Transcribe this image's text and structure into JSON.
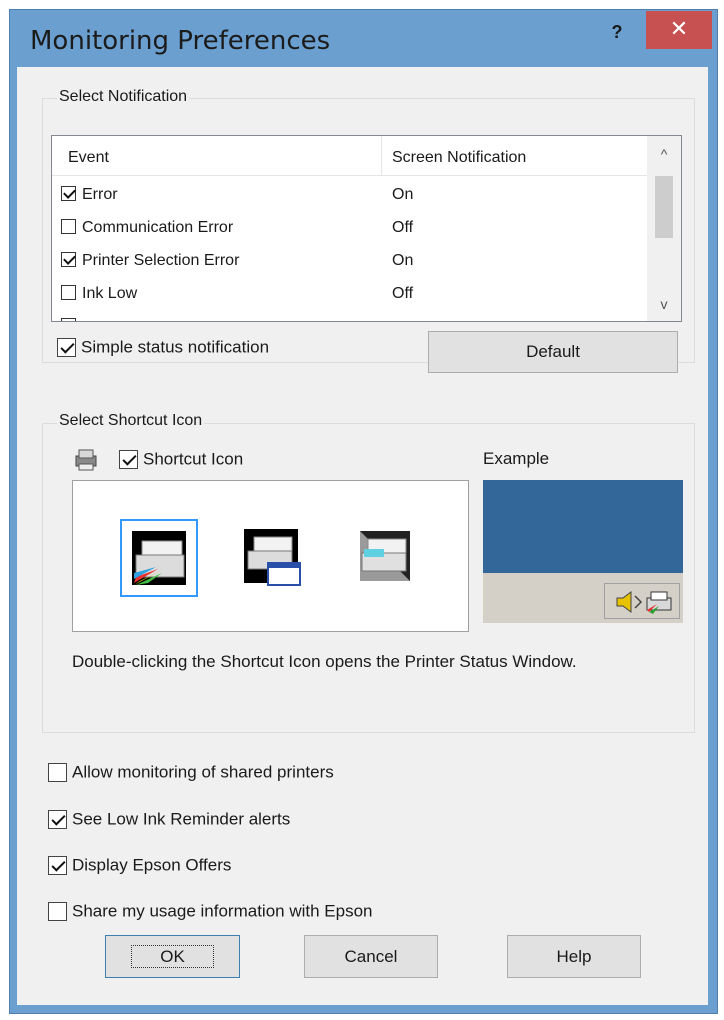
{
  "window": {
    "title": "Monitoring Preferences",
    "help_label": "?",
    "close_label": "✕"
  },
  "notification": {
    "group_title": "Select Notification",
    "columns": [
      "Event",
      "Screen Notification"
    ],
    "rows": [
      {
        "event": "Error",
        "status": "On",
        "checked": true
      },
      {
        "event": "Communication Error",
        "status": "Off",
        "checked": false
      },
      {
        "event": "Printer Selection Error",
        "status": "On",
        "checked": true
      },
      {
        "event": "Ink Low",
        "status": "Off",
        "checked": false
      }
    ],
    "scroll_up": "^",
    "scroll_down": "v",
    "simple_status_label": "Simple status notification",
    "simple_status_checked": true,
    "default_button": "Default"
  },
  "shortcut": {
    "group_title": "Select Shortcut Icon",
    "shortcut_label": "Shortcut Icon",
    "shortcut_checked": true,
    "example_label": "Example",
    "description": "Double-clicking the Shortcut Icon opens the Printer Status Window."
  },
  "options": [
    {
      "label": "Allow monitoring of shared printers",
      "checked": false
    },
    {
      "label": "See Low Ink Reminder alerts",
      "checked": true
    },
    {
      "label": "Display Epson Offers",
      "checked": true
    },
    {
      "label": "Share my usage information with Epson",
      "checked": false
    }
  ],
  "buttons": {
    "ok": "OK",
    "cancel": "Cancel",
    "help": "Help"
  },
  "colors": {
    "titlebar": "#6b9fcf",
    "close": "#c75050",
    "example_desktop": "#336699",
    "selection": "#3399ff"
  }
}
